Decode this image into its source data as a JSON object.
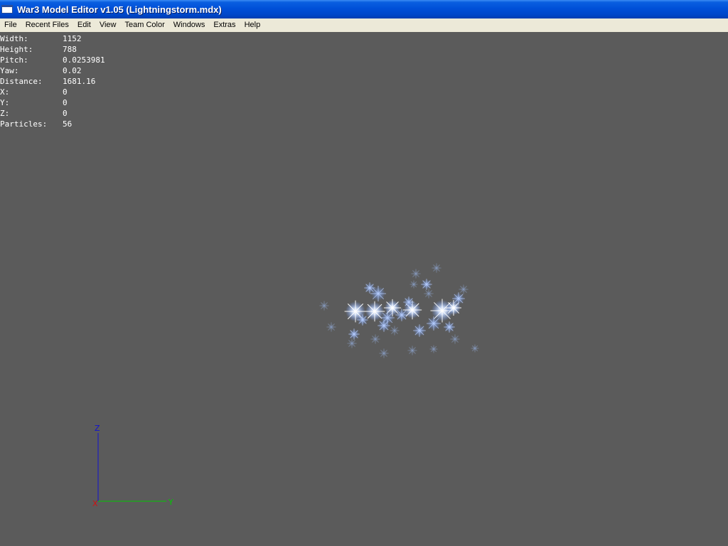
{
  "window": {
    "title": "War3 Model Editor v1.05 (Lightningstorm.mdx)",
    "icon": "app-window-icon"
  },
  "menu": {
    "items": [
      {
        "label": "File",
        "name": "menu-file"
      },
      {
        "label": "Recent Files",
        "name": "menu-recent-files"
      },
      {
        "label": "Edit",
        "name": "menu-edit"
      },
      {
        "label": "View",
        "name": "menu-view"
      },
      {
        "label": "Team Color",
        "name": "menu-team-color"
      },
      {
        "label": "Windows",
        "name": "menu-windows"
      },
      {
        "label": "Extras",
        "name": "menu-extras"
      },
      {
        "label": "Help",
        "name": "menu-help"
      }
    ]
  },
  "stats": [
    {
      "label": "Width:",
      "value": "1152"
    },
    {
      "label": "Height:",
      "value": "788"
    },
    {
      "label": "Pitch:",
      "value": "0.0253981"
    },
    {
      "label": "Yaw:",
      "value": "0.02"
    },
    {
      "label": "Distance:",
      "value": "1681.16"
    },
    {
      "label": "X:",
      "value": "0"
    },
    {
      "label": "Y:",
      "value": "0"
    },
    {
      "label": "Z:",
      "value": "0"
    },
    {
      "label": "Particles:",
      "value": "56"
    }
  ],
  "axes": {
    "z_label": "Z",
    "y_label": "Y",
    "x_label": "X",
    "z_color": "#1010d0",
    "y_color": "#00c800",
    "x_color": "#d01010"
  },
  "colors": {
    "viewport_bg": "#5b5b5b",
    "menubar_bg": "#ece9d8",
    "titlebar_blue": "#0050d8",
    "particle_glow": "#8fb4ff"
  }
}
